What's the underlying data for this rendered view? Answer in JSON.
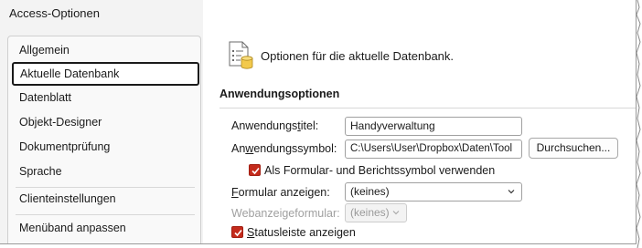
{
  "window": {
    "title": "Access-Optionen"
  },
  "nav": {
    "items": [
      {
        "label": "Allgemein"
      },
      {
        "label": "Aktuelle Datenbank"
      },
      {
        "label": "Datenblatt"
      },
      {
        "label": "Objekt-Designer"
      },
      {
        "label": "Dokumentprüfung"
      },
      {
        "label": "Sprache"
      },
      {
        "label": "Clienteinstellungen"
      },
      {
        "label": "Menüband anpassen"
      }
    ],
    "selected": "Aktuelle Datenbank"
  },
  "header": {
    "text": "Optionen für die aktuelle Datenbank.",
    "icon": "database-options-icon"
  },
  "section": {
    "title": "Anwendungsoptionen"
  },
  "fields": {
    "app_title": {
      "label_pre": "Anwendungs",
      "label_u": "t",
      "label_post": "itel:",
      "value": "Handyverwaltung"
    },
    "app_icon": {
      "label_pre": "An",
      "label_u": "w",
      "label_post": "endungssymbol:",
      "value": "C:\\Users\\User\\Dropbox\\Daten\\Tool",
      "browse_label": "Durchsuchen..."
    },
    "use_icon_checkbox": {
      "label": "Als Formular- und Berichtssymbol verwenden",
      "checked": true
    },
    "display_form": {
      "label_u": "F",
      "label_post": "ormular anzeigen:",
      "value": "(keines)"
    },
    "web_display_form": {
      "label": "Webanzeigeformular:",
      "value": "(keines)",
      "disabled": true
    },
    "statusbar_checkbox": {
      "label_u": "S",
      "label_post": "tatusleiste anzeigen",
      "checked": true
    }
  },
  "colors": {
    "accent_checkbox": "#c42b1c"
  }
}
